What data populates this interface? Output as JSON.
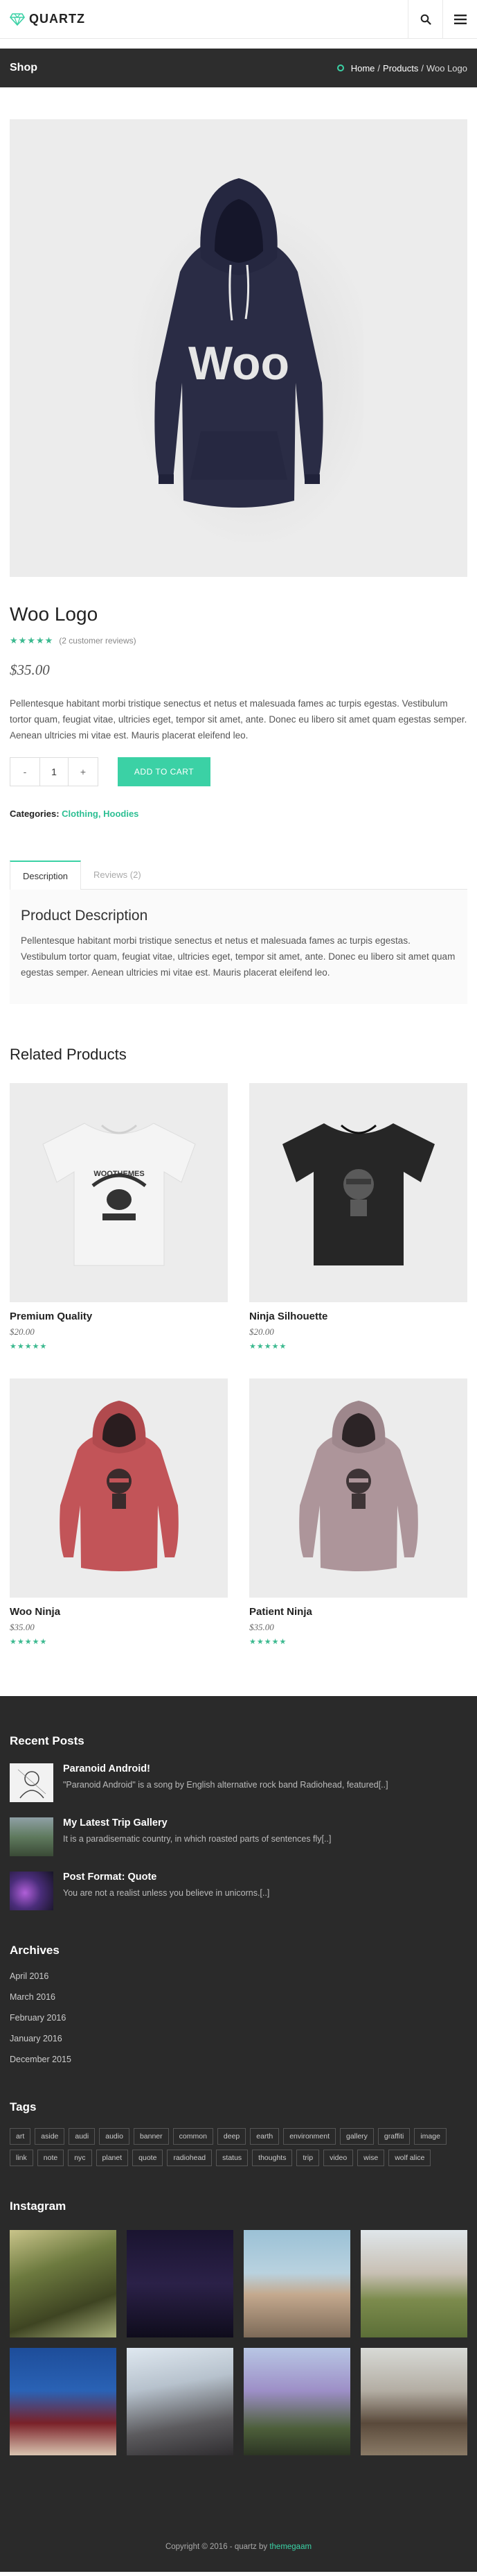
{
  "header": {
    "logo_text": "QUARTZ",
    "search_icon": "search-icon",
    "menu_icon": "hamburger-menu-icon"
  },
  "shopbar": {
    "title": "Shop",
    "breadcrumb": {
      "home": "Home",
      "sep1": "/",
      "products": "Products",
      "sep2": "/",
      "current": "Woo Logo"
    }
  },
  "product": {
    "title": "Woo Logo",
    "rating": 4.5,
    "reviews_text": "(2 customer reviews)",
    "price": "$35.00",
    "description": "Pellentesque habitant morbi tristique senectus et netus et malesuada fames ac turpis egestas. Vestibulum tortor quam, feugiat vitae, ultricies eget, tempor sit amet, ante. Donec eu libero sit amet quam egestas semper. Aenean ultricies mi vitae est. Mauris placerat eleifend leo.",
    "qty_minus": "-",
    "qty_value": "1",
    "qty_plus": "+",
    "add_to_cart": "ADD TO CART",
    "categories_label": "Categories:",
    "cat1": "Clothing",
    "cat_sep": ",",
    "cat2": "Hoodies",
    "hoodie_text": "Woo"
  },
  "tabs": {
    "description": "Description",
    "reviews": "Reviews (2)",
    "heading": "Product Description",
    "text": "Pellentesque habitant morbi tristique senectus et netus et malesuada fames ac turpis egestas. Vestibulum tortor quam, feugiat vitae, ultricies eget, tempor sit amet, ante. Donec eu libero sit amet quam egestas semper. Aenean ultricies mi vitae est. Mauris placerat eleifend leo."
  },
  "related": {
    "title": "Related Products",
    "items": [
      {
        "name": "Premium Quality",
        "price": "$20.00",
        "rating": 5,
        "tshirt_text": "WOOTHEMES"
      },
      {
        "name": "Ninja Silhouette",
        "price": "$20.00",
        "rating": 5
      },
      {
        "name": "Woo Ninja",
        "price": "$35.00",
        "rating": 5
      },
      {
        "name": "Patient Ninja",
        "price": "$35.00",
        "rating": 5
      }
    ]
  },
  "footer": {
    "recent_posts_title": "Recent Posts",
    "posts": [
      {
        "title": "Paranoid Android!",
        "excerpt": "\"Paranoid Android\" is a song by English alternative rock band Radiohead, featured[..]"
      },
      {
        "title": "My Latest Trip Gallery",
        "excerpt": "It is a paradisematic country, in which roasted parts of sentences fly[..]"
      },
      {
        "title": "Post Format: Quote",
        "excerpt": "You are not a realist unless you believe in unicorns.[..]"
      }
    ],
    "archives_title": "Archives",
    "archives": [
      "April 2016",
      "March 2016",
      "February 2016",
      "January 2016",
      "December 2015"
    ],
    "tags_title": "Tags",
    "tags": [
      "art",
      "aside",
      "audi",
      "audio",
      "banner",
      "common",
      "deep",
      "earth",
      "environment",
      "gallery",
      "graffiti",
      "image",
      "link",
      "note",
      "nyc",
      "planet",
      "quote",
      "radiohead",
      "status",
      "thoughts",
      "trip",
      "video",
      "wise",
      "wolf alice"
    ],
    "instagram_title": "Instagram",
    "copyright_prefix": "Copyright © 2016 - quartz by",
    "copyright_link": "themegaam"
  },
  "colors": {
    "accent": "#3bd1a5",
    "dark_bar": "#2d2d2d",
    "footer_bg": "#2a2a2a",
    "star": "#3bb98f"
  }
}
